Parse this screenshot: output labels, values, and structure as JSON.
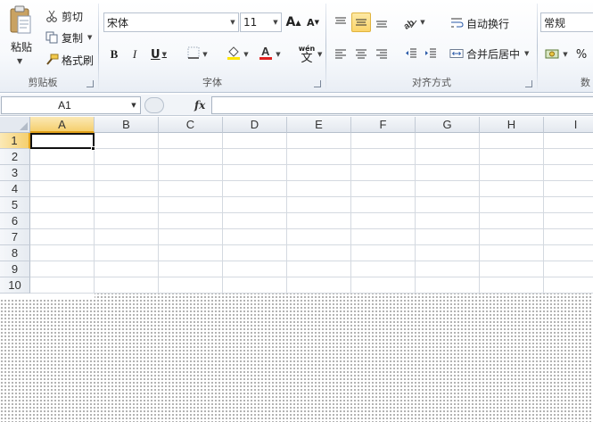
{
  "ribbon": {
    "clipboard": {
      "paste_label": "粘贴",
      "cut_label": "剪切",
      "copy_label": "复制",
      "format_painter_label": "格式刷",
      "group_label": "剪贴板"
    },
    "font": {
      "font_name": "宋体",
      "font_size": "11",
      "grow_label": "A",
      "shrink_label": "A",
      "bold_label": "B",
      "italic_label": "I",
      "underline_label": "U",
      "phonetic_label": "wén",
      "phonetic_char": "文",
      "group_label": "字体",
      "font_color": "#e02020",
      "fill_color": "#ffe600"
    },
    "alignment": {
      "wrap_text_label": "自动换行",
      "merge_center_label": "合并后居中",
      "group_label": "对齐方式"
    },
    "number": {
      "format_value": "常规",
      "percent_label": "%",
      "group_label_partial": "数"
    }
  },
  "formula_bar": {
    "name_box": "A1",
    "fx_label": "fx",
    "formula_value": ""
  },
  "sheet": {
    "columns": [
      "A",
      "B",
      "C",
      "D",
      "E",
      "F",
      "G",
      "H",
      "I"
    ],
    "rows": [
      "1",
      "2",
      "3",
      "4",
      "5",
      "6",
      "7",
      "8",
      "9",
      "10"
    ],
    "active_cell": "A1",
    "selection_color": "#f5cf6e"
  }
}
